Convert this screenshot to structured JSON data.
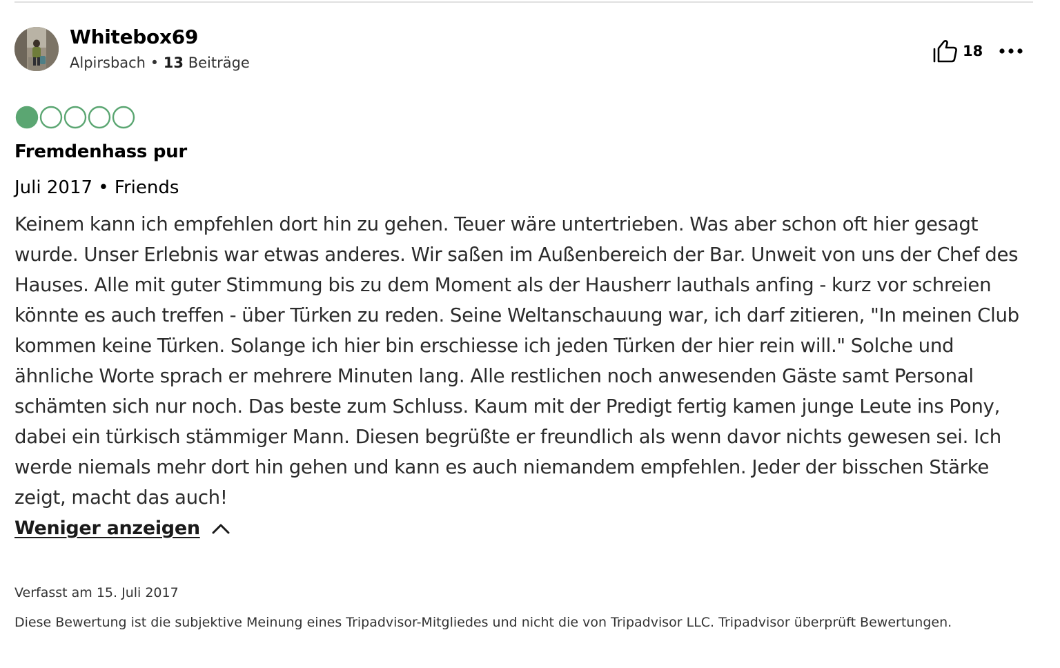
{
  "reviewer": {
    "name": "Whitebox69",
    "location": "Alpirsbach",
    "separator": "•",
    "contributions_count": "13",
    "contributions_label": "Beiträge",
    "avatar_icon": "traveler-photo-avatar"
  },
  "actions": {
    "helpful_icon": "thumbs-up-icon",
    "helpful_count": "18",
    "more_icon": "more-horizontal-icon"
  },
  "rating": {
    "value": 1,
    "max": 5,
    "color": "#5BA672"
  },
  "review": {
    "title": "Fremdenhass pur",
    "visit_date": "Juli 2017",
    "separator": "•",
    "trip_type": "Friends",
    "text": "Keinem kann ich empfehlen dort hin zu gehen. Teuer wäre untertrieben. Was aber schon oft hier gesagt wurde. Unser Erlebnis war etwas anderes. Wir saßen im Außenbereich der Bar. Unweit von uns der Chef des Hauses. Alle mit guter Stimmung bis zu dem Moment als der Hausherr lauthals anfing - kurz vor schreien könnte es auch treffen - über Türken zu reden. Seine Weltanschauung war, ich darf zitieren, \"In meinen Club kommen keine Türken. Solange ich hier bin erschiesse ich jeden Türken der hier rein will.\" Solche und ähnliche Worte sprach er mehrere Minuten lang. Alle restlichen noch anwesenden Gäste samt Personal schämten sich nur noch. Das beste zum Schluss. Kaum mit der Predigt fertig kamen junge Leute ins Pony, dabei ein türkisch stämmiger Mann. Diesen begrüßte er freundlich als wenn davor nichts gewesen sei. Ich werde niemals mehr dort hin gehen und kann es auch niemandem empfehlen. Jeder der bisschen Stärke zeigt, macht das auch!",
    "show_less_label": "Weniger anzeigen",
    "show_less_icon": "chevron-up-icon"
  },
  "footer": {
    "written_date": "Verfasst am 15. Juli 2017",
    "disclaimer": "Diese Bewertung ist die subjektive Meinung eines Tripadvisor-Mitgliedes und nicht die von Tripadvisor LLC. Tripadvisor überprüft Bewertungen."
  }
}
